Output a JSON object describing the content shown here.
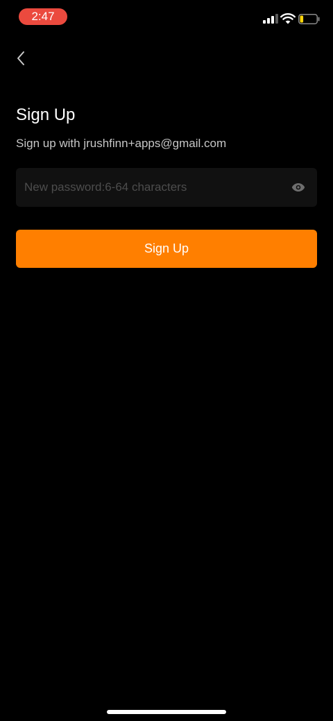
{
  "status_bar": {
    "time": "2:47",
    "time_pill_color": "#eb4a3e",
    "signal_icon": "cellular-signal-icon",
    "wifi_icon": "wifi-icon",
    "battery_icon": "battery-low-icon",
    "battery_level": 0.2
  },
  "header": {
    "back_icon": "chevron-left-icon"
  },
  "form": {
    "title": "Sign Up",
    "subtitle": "Sign up with jrushfinn+apps@gmail.com",
    "password": {
      "value": "",
      "placeholder": "New password:6-64 characters",
      "toggle_icon": "eye-icon"
    },
    "submit_label": "Sign Up"
  },
  "colors": {
    "background": "#000000",
    "accent": "#ff7f00",
    "field_background": "#111111",
    "subtitle_text": "#c7c7c7",
    "placeholder_text": "#4d4d4d"
  }
}
